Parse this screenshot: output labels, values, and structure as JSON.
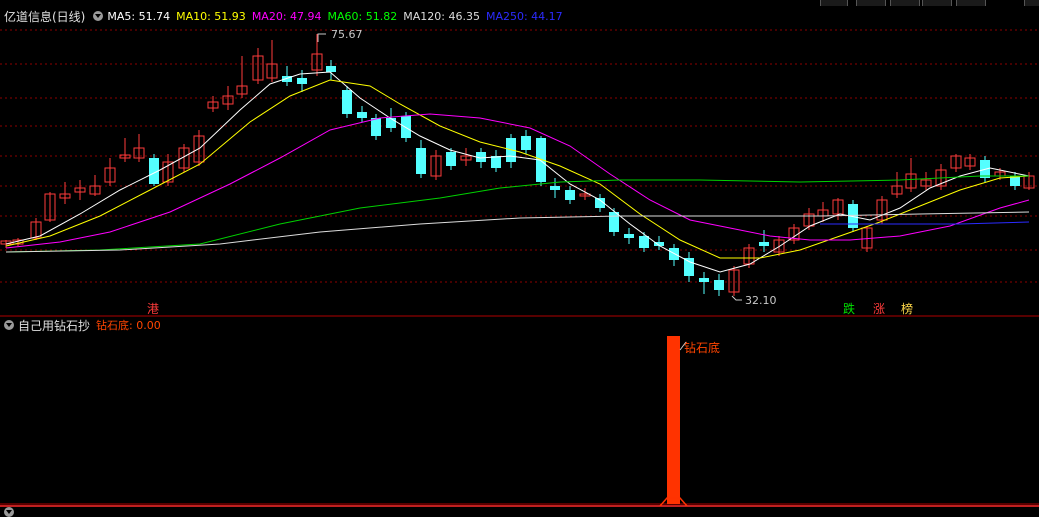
{
  "main_panel": {
    "title": "亿道信息(日线)",
    "indicators": [
      {
        "label": "MA5: 51.74",
        "color": "#ffffff"
      },
      {
        "label": "MA10: 51.93",
        "color": "#ffff00"
      },
      {
        "label": "MA20: 47.94",
        "color": "#ff00ff"
      },
      {
        "label": "MA60: 51.82",
        "color": "#00ff00"
      },
      {
        "label": "MA120: 46.35",
        "color": "#dcdcdc"
      },
      {
        "label": "MA250: 44.17",
        "color": "#2b2bff"
      }
    ],
    "high_label": "75.67",
    "low_label": "32.10",
    "markers": [
      {
        "text": "港",
        "color": "#ff3b3b"
      },
      {
        "text": "跌",
        "color": "#00e000"
      },
      {
        "text": "涨",
        "color": "#ff3b3b"
      },
      {
        "text": "榜",
        "color": "#ffd84a"
      }
    ]
  },
  "sub_panel": {
    "title": "自己用钻石抄",
    "indicator": "钻石底: 0.00",
    "indicator_color": "#ff4500",
    "signal_label": "钻石底"
  },
  "bottom_panel": {
    "title": "",
    "indicator": ""
  },
  "colors": {
    "up": "#ff3b3b",
    "down": "#54ffff",
    "grid": "#8b0000",
    "signal": "#ff3300"
  }
}
